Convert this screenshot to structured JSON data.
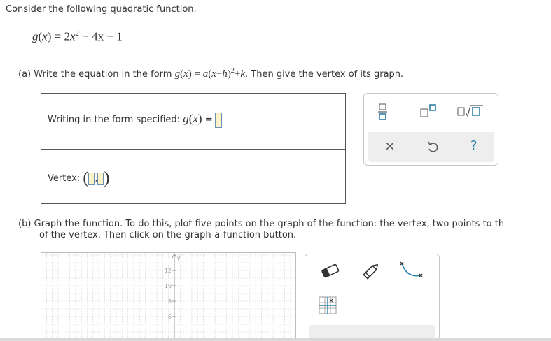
{
  "intro": "Consider the following quadratic function.",
  "function": {
    "lhs": "g",
    "var": "x",
    "eq": "=",
    "a": "2",
    "exp": "2",
    "rest": "− 4x − 1"
  },
  "part_a": {
    "label": "(a)",
    "text1": "Write the equation in the form",
    "form": {
      "g": "g",
      "x": "x",
      "eq": "=",
      "a": "a",
      "h": "h",
      "exp": "2",
      "k": "k"
    },
    "text2": ". Then give the vertex of its graph."
  },
  "answer": {
    "row1_label": "Writing in the form specified:",
    "row1_math_g": "g",
    "row1_math_x": "x",
    "row1_eq": "=",
    "vertex_label": "Vertex:",
    "vertex_comma": ","
  },
  "keypad": {
    "buttons": [
      "fraction-icon",
      "exponent-icon",
      "sqrt-icon",
      "clear-icon",
      "undo-icon",
      "help-icon"
    ],
    "clear_label": "×",
    "help_label": "?"
  },
  "part_b": {
    "label": "(b)",
    "line1": "Graph the function. To do this, plot five points on the graph of the function: the vertex, two points to th",
    "line2": "of the vertex. Then click on the graph-a-function button."
  },
  "graph": {
    "y_axis_label": "y",
    "y_ticks": [
      "12",
      "10",
      "8",
      "6"
    ]
  },
  "toolbox": {
    "tools": [
      "eraser-icon",
      "pencil-icon",
      "parabola-icon",
      "points-grid-icon"
    ]
  },
  "colors": {
    "accent": "#2c7ea8",
    "slot_fill": "#fdf3c8",
    "slot_border": "#6a8fb7",
    "grid": "#cfcfcf"
  }
}
